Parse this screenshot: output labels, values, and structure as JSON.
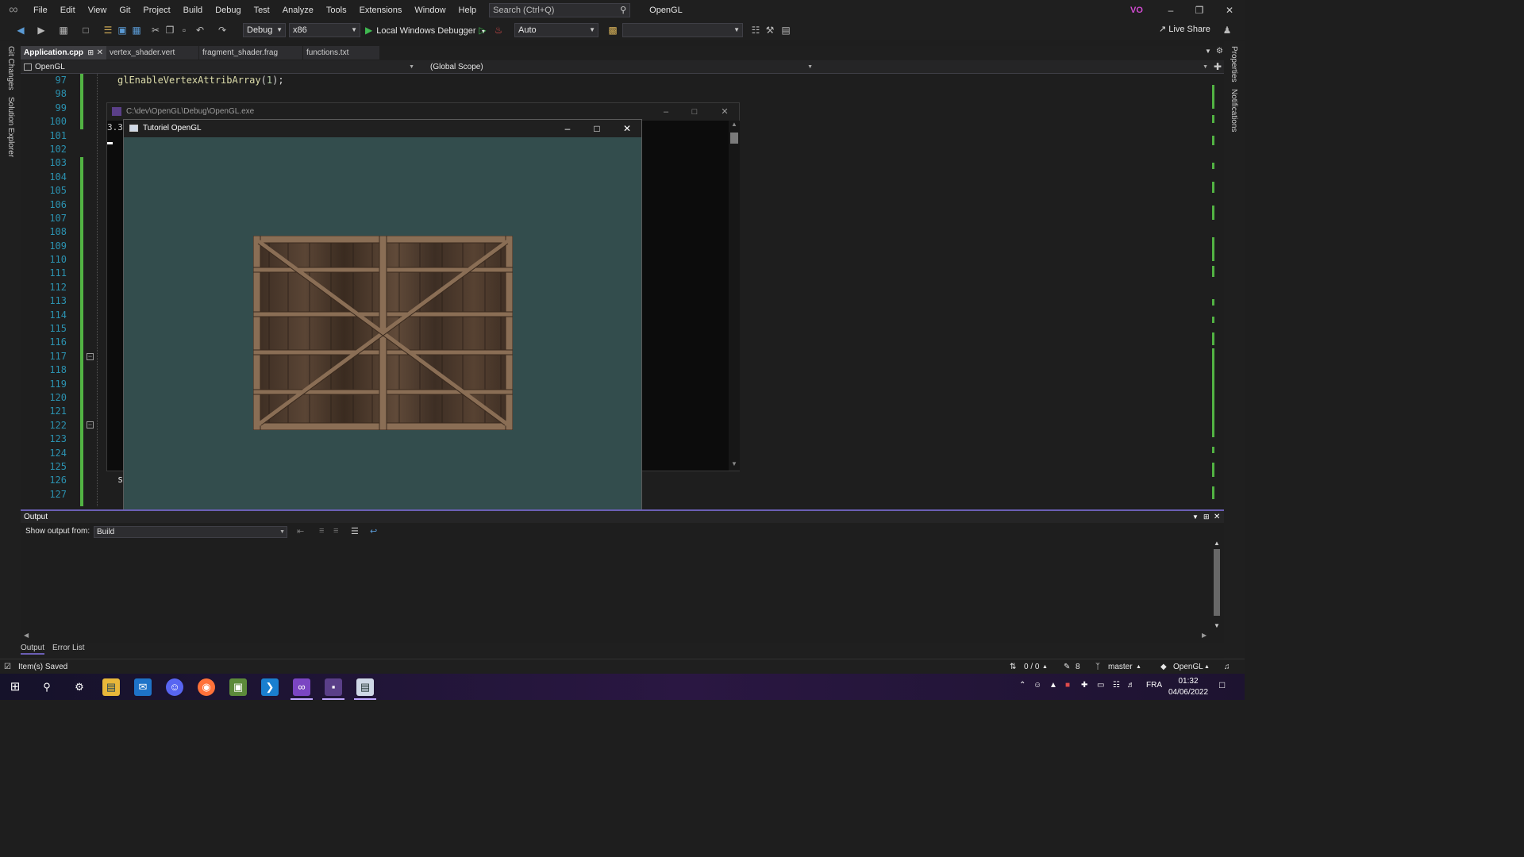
{
  "menubar": {
    "items": [
      "File",
      "Edit",
      "View",
      "Git",
      "Project",
      "Build",
      "Debug",
      "Test",
      "Analyze",
      "Tools",
      "Extensions",
      "Window",
      "Help"
    ],
    "search_placeholder": "Search (Ctrl+Q)",
    "solution_name": "OpenGL",
    "user_initials": "VO"
  },
  "toolbar": {
    "config": "Debug",
    "platform": "x86",
    "debugger": "Local Windows Debugger",
    "mode": "Auto",
    "live_share": "Live Share"
  },
  "side_tabs": {
    "left": [
      "Git Changes",
      "Solution Explorer"
    ],
    "right": [
      "Properties",
      "Notifications"
    ]
  },
  "doc_tabs": [
    "Application.cpp",
    "vertex_shader.vert",
    "fragment_shader.frag",
    "functions.txt"
  ],
  "navbar": {
    "project": "OpenGL",
    "scope": "(Global Scope)"
  },
  "editor": {
    "line_numbers": [
      "97",
      "98",
      "99",
      "100",
      "101",
      "102",
      "103",
      "104",
      "105",
      "106",
      "107",
      "108",
      "109",
      "110",
      "111",
      "112",
      "113",
      "114",
      "115",
      "116",
      "117",
      "118",
      "119",
      "120",
      "121",
      "122",
      "123",
      "124",
      "125",
      "126",
      "127"
    ],
    "code_fn": "glEnableVertexAttribArray",
    "code_open": "(",
    "code_arg": "1",
    "code_close": ");",
    "code_fragment": "s"
  },
  "console": {
    "title": "C:\\dev\\OpenGL\\Debug\\OpenGL.exe",
    "text": "3.3"
  },
  "gl_window": {
    "title": "Tutoriel OpenGL",
    "clear_color": "#334d4d"
  },
  "output": {
    "title": "Output",
    "show_from_label": "Show output from:",
    "source": "Build"
  },
  "bottom_tabs": [
    "Output",
    "Error List"
  ],
  "statusbar": {
    "message": "Item(s) Saved",
    "sync": "0 / 0",
    "pending": "8",
    "branch": "master",
    "repo": "OpenGL"
  },
  "taskbar": {
    "language": "FRA",
    "time": "01:32",
    "date": "04/06/2022"
  },
  "colors": {
    "accent": "#6b5fb5",
    "change_bar": "#52b343",
    "line_number": "#2b91af"
  }
}
